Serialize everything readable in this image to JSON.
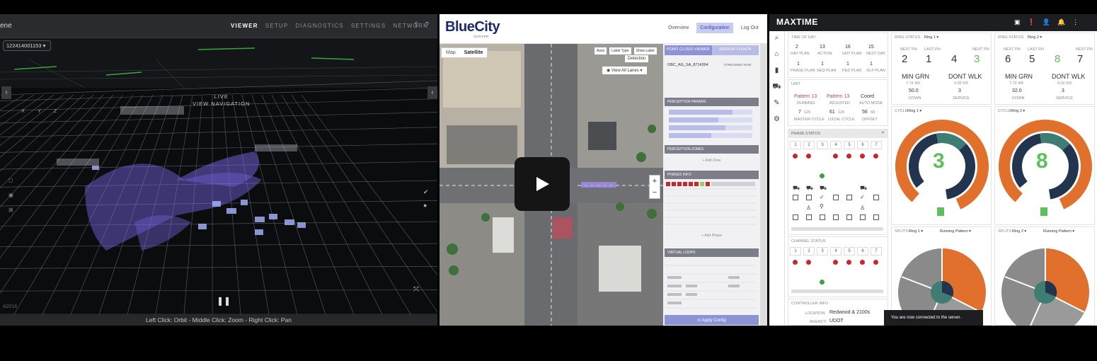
{
  "lidar": {
    "title": "ene",
    "nav": [
      "VIEWER",
      "SETUP",
      "DIAGNOSTICS",
      "SETTINGS",
      "NETWORK"
    ],
    "sensor_select": "122414001153",
    "hint_line1": "LIVE",
    "hint_line2": "VIEW NAVIGATION",
    "axes": "X Y Z",
    "version": "A2016",
    "status_bar": "Left Click: Orbit - Middle Click: Zoom - Right Click: Pan",
    "colors": {
      "point_cloud": "#7b6cf0",
      "road": "#3ec23e"
    }
  },
  "bluecity": {
    "logo": "BlueCity",
    "logo_sub": "OUSTER",
    "nav": [
      "Overview",
      "Configuration",
      "Log Out"
    ],
    "map_tabs": [
      "Map",
      "Satellite"
    ],
    "map_tools": [
      "Axes",
      "Label Type",
      "Show Label"
    ],
    "detection": "Detection",
    "view_all": "View All Lanes",
    "panel_tabs": [
      "POINT CLOUD VIEWER",
      "SENSOR FUSION"
    ],
    "intersection_id": "OBC_AG_SA_8714394",
    "streaming": "STREAMING RAW",
    "sections": [
      "PERCEPTION PARAMS",
      "PERCEPTION ZONES",
      "PHASES INFO",
      "VIRTUAL LOOPS"
    ],
    "add_zone": "+ Add Zone",
    "add_phase": "+ Add Phase",
    "apply": "Apply Config",
    "colors": {
      "accent": "#8e92d6",
      "logo": "#1a2a6c"
    }
  },
  "maxtime": {
    "title": "MAXTIME",
    "time_of_day_label": "TIME OF DAY",
    "tod": [
      {
        "v": "2",
        "l": "DAY PLAN"
      },
      {
        "v": "13",
        "l": "ACTION"
      },
      {
        "v": "16",
        "l": "HOT PLAN"
      },
      {
        "v": "15",
        "l": "NEXT DAY"
      },
      {
        "v": "1",
        "l": "PHASE PLAN"
      },
      {
        "v": "1",
        "l": "SEQ PLAN"
      },
      {
        "v": "1",
        "l": "PED PLAN"
      },
      {
        "v": "1",
        "l": "OLP PLAN"
      }
    ],
    "unit_label": "UNIT",
    "unit": [
      {
        "v": "Pattern 13",
        "l": "RUNNING",
        "red": true
      },
      {
        "v": "Pattern 13",
        "l": "ADJUSTED",
        "red": true
      },
      {
        "v": "Coord",
        "l": "AUTO MODE",
        "red": false
      },
      {
        "v": "7",
        "l": "MASTER CYCLE",
        "sub": "120"
      },
      {
        "v": "61",
        "l": "LOCAL CYCLE",
        "sub": "120"
      },
      {
        "v": "56",
        "l": "OFFSET",
        "sub": "60"
      }
    ],
    "phase_status_label": "PHASE STATUS",
    "phase_numbers": [
      "1",
      "2",
      "3",
      "4",
      "5",
      "6",
      "7"
    ],
    "channel_status_label": "CHANNEL STATUS",
    "channel_numbers": [
      "1",
      "2",
      "3",
      "4",
      "5",
      "6",
      "7"
    ],
    "controller_label": "CONTROLLER INFO",
    "location_label": "LOCATION",
    "location": "Redwood & 2100s",
    "agency_label": "AGENCY",
    "agency": "UDOT",
    "ring1": {
      "status_label": "RING STATUS",
      "ring": "Ring 1",
      "phases": [
        "2",
        "1",
        "4",
        "3"
      ],
      "phase_labels": [
        "NEXT PH",
        "LAST PH",
        "",
        "NEXT PH"
      ],
      "min_grn": "MIN GRN",
      "dont_wlk": "DONT WLK",
      "min_sub": "7.72 4/6",
      "dont_sub": "0.02 0/0",
      "val1": "50.0",
      "val1_lbl": "DOWN",
      "val2": "3",
      "val2_lbl": "SERVICE",
      "cycle_label": "CYCLE",
      "cycle_value": "3",
      "splits_label": "SPLITS",
      "splits_pattern": "Running Pattern"
    },
    "ring2": {
      "status_label": "RING STATUS",
      "ring": "Ring 2",
      "phases": [
        "6",
        "5",
        "8",
        "7"
      ],
      "phase_labels": [
        "NEXT PH",
        "LAST PH",
        "",
        "NEXT PH"
      ],
      "min_grn": "MIN GRN",
      "dont_wlk": "DONT WLK",
      "min_sub": "7.72 4/6",
      "dont_sub": "0.02 0/0",
      "val1": "32.0",
      "val1_lbl": "DOWN",
      "val2": "3",
      "val2_lbl": "SERVICE",
      "cycle_label": "CYCLE",
      "cycle_value": "8",
      "splits_label": "SPLITS",
      "splits_pattern": "Running Pattern"
    },
    "toast": "You are now connected to the server.",
    "colors": {
      "orange": "#e0702c",
      "navy": "#23344f",
      "teal": "#3f7d74",
      "green": "#5cc05c",
      "red": "#c8282c",
      "grey": "#8a8a8a"
    }
  }
}
